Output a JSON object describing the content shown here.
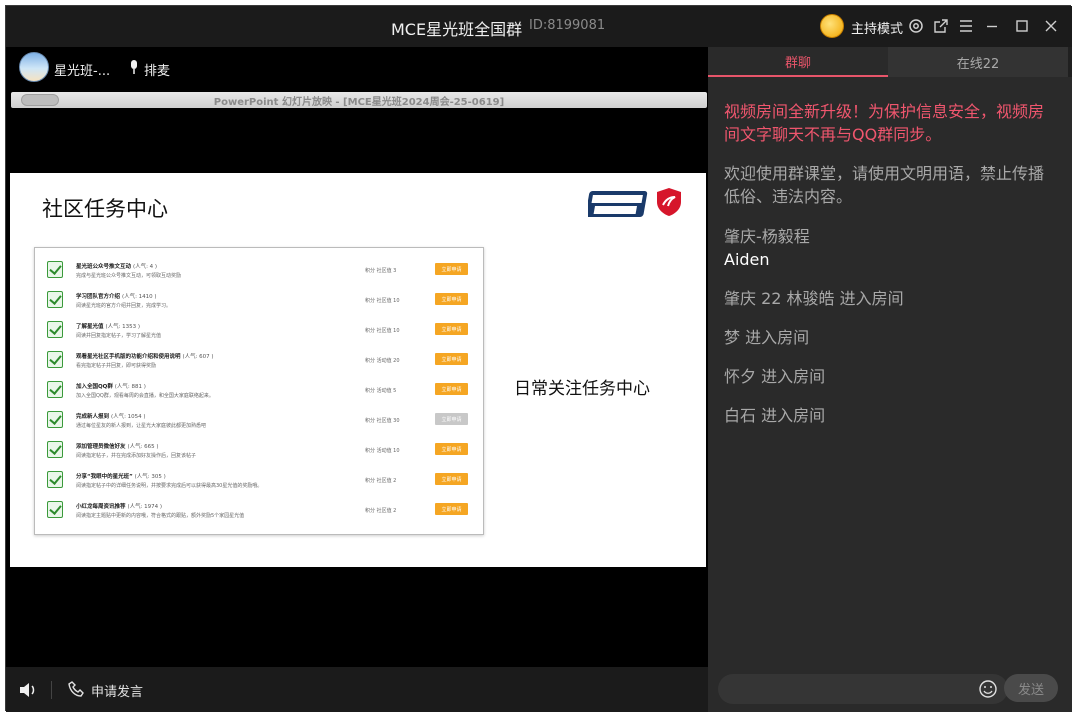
{
  "window": {
    "title": "MCE星光班全国群",
    "room_id": "ID:8199081",
    "host_mode_label": "主持模式"
  },
  "room": {
    "name": "星光班-...",
    "queue_label": "排麦"
  },
  "ppt": {
    "title": "PowerPoint 幻灯片放映 - [MCE星光班2024周会-25-0619]"
  },
  "slide": {
    "title": "社区任务中心",
    "side_text": "日常关注任务中心",
    "tasks": [
      {
        "name": "星光班公众号推文互动",
        "pop": "(人气: 4 )",
        "desc": "完成与星光班公众号推文互动，可领取互动奖励",
        "score": "积分 社区值 3",
        "btn": "立即申请"
      },
      {
        "name": "学习团队官方介绍",
        "pop": "(人气: 1410 )",
        "desc": "阅读星光班的官方介绍并回复，完成学习。",
        "score": "积分 社区值 10",
        "btn": "立即申请"
      },
      {
        "name": "了解星光值",
        "pop": "(人气: 1353 )",
        "desc": "阅读并回复指定帖子，学习了解星光值",
        "score": "积分 社区值 10",
        "btn": "立即申请"
      },
      {
        "name": "观看星光社区手机版的功能介绍和使用说明",
        "pop": "(人气: 607 )",
        "desc": "看完指定帖子并回复，即可获得奖励",
        "score": "积分 活动值 20",
        "btn": "立即申请"
      },
      {
        "name": "加入全国QQ群",
        "pop": "(人气: 881 )",
        "desc": "加入全国QQ群，观看每周的会直播，和全国大家庭联络起来。",
        "score": "积分 活动值 5",
        "btn": "立即申请"
      },
      {
        "name": "完成新人报到",
        "pop": "(人气: 1054 )",
        "desc": "通过每位星友的新人报到，让星光大家庭彼此都更加熟悉吧",
        "score": "积分 社区值 30",
        "btn": "立即申请",
        "disabled": true
      },
      {
        "name": "添加管理员微信好友",
        "pop": "(人气: 665 )",
        "desc": "阅读指定帖子，并在完成添加好友操作后，回复该帖子",
        "score": "积分 活动值 10",
        "btn": "立即申请"
      },
      {
        "name": "分享“我眼中的星光班”",
        "pop": "(人气: 305 )",
        "desc": "阅读指定帖子中的详细任务说明，并按要求完成后可以获得最高30星光值的奖励哦。",
        "score": "积分 社区值 2",
        "btn": "立即申请"
      },
      {
        "name": "小红龙每周资讯推荐",
        "pop": "(人气: 1974 )",
        "desc": "阅读指定主题贴中更新的内容哦，符合格式的跟贴，额外奖励5个家园星光值",
        "score": "积分 社区值 2",
        "btn": "立即申请"
      }
    ]
  },
  "bottom": {
    "apply_label": "申请发言"
  },
  "chat": {
    "tab_chat": "群聊",
    "tab_online": "在线22",
    "notice": "视频房间全新升级！为保护信息安全，视频房间文字聊天不再与QQ群同步。",
    "welcome": "欢迎使用群课堂，请使用文明用语，禁止传播低俗、违法内容。",
    "message_sender": "肇庆-杨毅程",
    "message_text": "Aiden",
    "joins": [
      "肇庆 22 林骏皓 进入房间",
      "梦 进入房间",
      "怀夕 进入房间",
      "白石 进入房间"
    ],
    "input_placeholder": "",
    "send_label": "发送"
  },
  "colors": {
    "accent_red": "#e8556a",
    "task_button": "#f5a623"
  }
}
